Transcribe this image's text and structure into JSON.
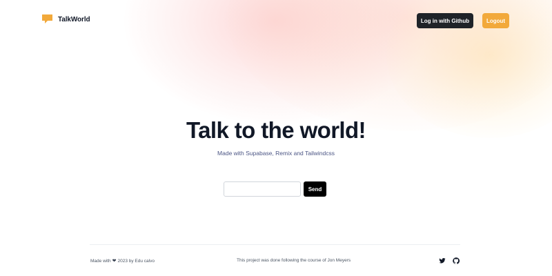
{
  "app": {
    "brand_name": "TalkWorld",
    "brand_icon": "chat-bubble-icon",
    "accent_color": "#f2a93b"
  },
  "header": {
    "github_login_label": "Log in with Github",
    "logout_label": "Logout"
  },
  "hero": {
    "title": "Talk to the world!",
    "subtitle": "Made with Supabase, Remix and Tailwindcss"
  },
  "form": {
    "input_value": "",
    "input_placeholder": "",
    "send_label": "Send"
  },
  "footer": {
    "made_with_prefix": "Made with",
    "heart_glyph": "❤",
    "made_with_suffix": "2023 by Edu calvo",
    "course_note": "This project was done following the course of Jon Meyers",
    "social_icons": [
      "twitter-icon",
      "github-icon"
    ]
  }
}
